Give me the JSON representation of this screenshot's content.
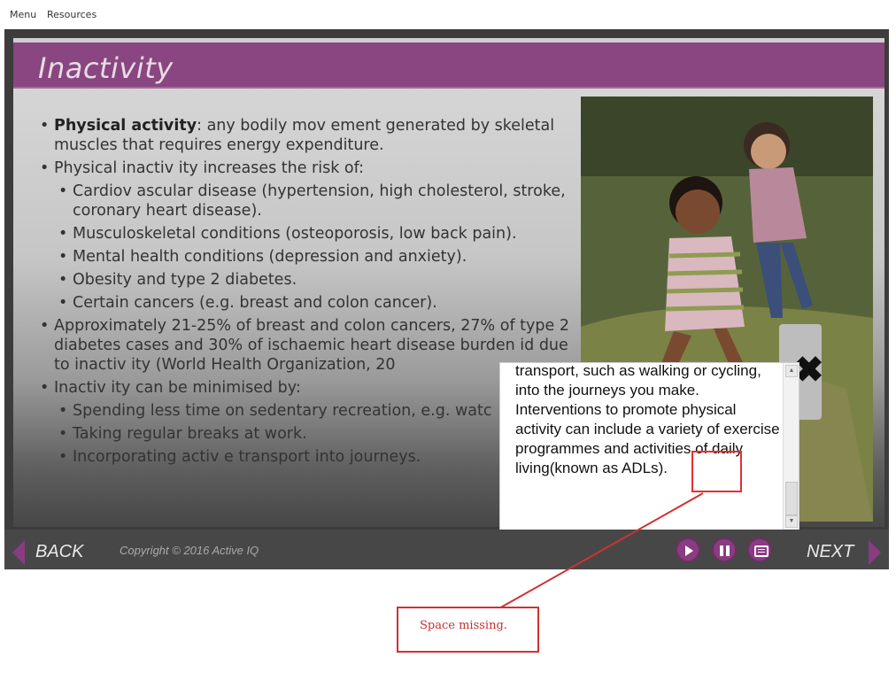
{
  "topnav": {
    "menu": "Menu",
    "resources": "Resources"
  },
  "slide": {
    "title": "Inactivity",
    "bullets": [
      {
        "bold": "Physical activity",
        "rest": ": any bodily mov ement generated by skeletal muscles that requires energy expenditure."
      },
      {
        "text": "Physical inactiv ity increases the risk of:"
      },
      {
        "text": "Cardiov ascular disease (hypertension, high cholesterol, stroke, coronary heart disease)."
      },
      {
        "text": "Musculoskeletal conditions (osteoporosis, low back pain)."
      },
      {
        "text": "Mental health conditions (depression and anxiety)."
      },
      {
        "text": "Obesity and type 2 diabetes."
      },
      {
        "text": "Certain cancers (e.g. breast and colon cancer)."
      },
      {
        "text": "Approximately 21-25% of breast and colon cancers, 27% of type 2 diabetes cases and 30% of ischaemic heart disease burden id due to inactiv ity (World Health Organization, 20"
      },
      {
        "text": "Inactiv ity can be minimised by:"
      },
      {
        "text": "Spending less time on sedentary recreation, e.g. watc"
      },
      {
        "text": "Taking regular breaks at work."
      },
      {
        "text": "Incorporating activ e transport into journeys."
      }
    ]
  },
  "popup": {
    "text": "transport, such as walking or cycling, into the journeys you make. Interventions to promote physical activity can include a variety of exercise programmes and activities of daily living(known as ADLs).",
    "close_glyph": "✖"
  },
  "controls": {
    "back": "BACK",
    "copyright": "Copyright © 2016 Active IQ",
    "next": "NEXT"
  },
  "annotation": {
    "text": "Space missing."
  },
  "colors": {
    "accent": "#8a4680",
    "annotation": "#cf3232"
  }
}
